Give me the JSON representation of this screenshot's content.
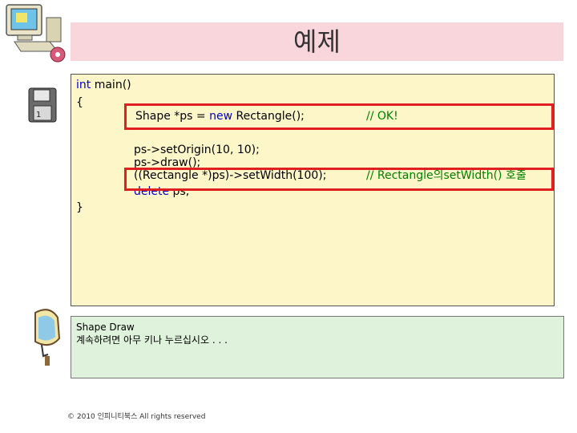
{
  "title": "예제",
  "code": {
    "line1_kw": "int",
    "line1_rest": " main()",
    "line2": "{",
    "line3_a": "Shape *ps = ",
    "line3_kw": "new",
    "line3_b": " Rectangle();",
    "line3_comment": "// OK!",
    "line4": "ps->setOrigin(10, 10);",
    "line5": "ps->draw();",
    "line6": "((Rectangle *)ps)->setWidth(100);",
    "line6_comment": "// Rectangle의setWidth() 호출",
    "line7_kw": "delete",
    "line7_rest": " ps;",
    "line8": "}"
  },
  "output": {
    "line1": "Shape Draw",
    "line2": "계속하려면 아무 키나 누르십시오 . . ."
  },
  "footer": "© 2010 인피니티북스  All rights reserved",
  "colors": {
    "title_bg": "#f9d6dc",
    "code_bg": "#fdf6c8",
    "output_bg": "#dff2dc",
    "keyword": "#0000cc",
    "comment": "#007f00",
    "highlight": "#e02020"
  },
  "icons": [
    "computer-icon",
    "floppy-disk-icon",
    "mirror-icon"
  ]
}
